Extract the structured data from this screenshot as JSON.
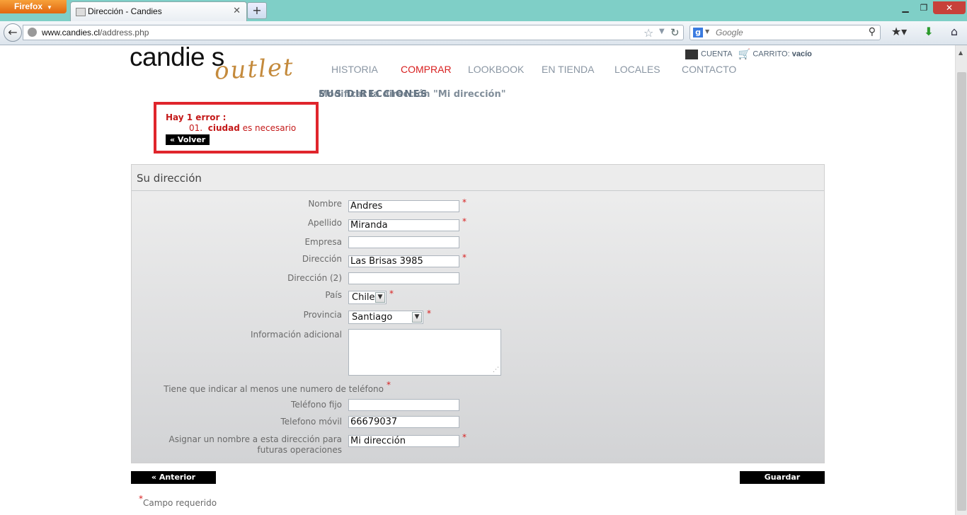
{
  "browser": {
    "app_button": "Firefox",
    "tab_title": "Dirección - Candies",
    "new_tab": "+",
    "url_host": "www.candies.cl",
    "url_path": "/address.php",
    "search_placeholder": "Google",
    "window_min": "▁",
    "window_max": "❐",
    "window_close": "✕"
  },
  "site": {
    "logo_main": "candie s",
    "logo_sub": "outlet",
    "nav": [
      "HISTORIA",
      "COMPRAR",
      "LOOKBOOK",
      "EN TIENDA",
      "LOCALES",
      "CONTACTO"
    ],
    "active_nav": "COMPRAR",
    "account_label": "CUENTA",
    "cart_label": "CARRITO:",
    "cart_status": "vacío",
    "crumb_overlap_a": "SUS DIRECCIONES",
    "crumb_overlap_b": "Modificar la dirección \"Mi dirección\""
  },
  "error": {
    "header": "Hay 1 error :",
    "item_number": "01.",
    "item_field": "ciudad",
    "item_msg": "es necesario",
    "back_label": "« Volver"
  },
  "form": {
    "title": "Su dirección",
    "fields": {
      "nombre": {
        "label": "Nombre",
        "value": "Andres"
      },
      "apellido": {
        "label": "Apellido",
        "value": "Miranda"
      },
      "empresa": {
        "label": "Empresa",
        "value": ""
      },
      "direccion": {
        "label": "Dirección",
        "value": "Las Brisas 3985"
      },
      "direccion2": {
        "label": "Dirección (2)",
        "value": ""
      },
      "pais": {
        "label": "País",
        "value": "Chile"
      },
      "provincia": {
        "label": "Provincia",
        "value": "Santiago"
      },
      "info": {
        "label": "Información adicional",
        "value": ""
      },
      "phone_note": {
        "label": "Tiene que indicar al menos une numero de teléfono"
      },
      "telefono_fijo": {
        "label": "Teléfono fijo",
        "value": ""
      },
      "telefono_movil": {
        "label": "Telefono móvil",
        "value": "66679037"
      },
      "alias": {
        "label": "Asignar un nombre a esta dirección para futuras operaciones",
        "value": "Mi dirección"
      }
    },
    "required_mark": "*",
    "prev_button": "« Anterior",
    "save_button": "Guardar",
    "required_note": "Campo requerido"
  },
  "colors": {
    "accent_red": "#d81f1f",
    "error_border": "#e0252c",
    "firefox_orange": "#e0660e",
    "titlebar": "#7fcfc7"
  }
}
